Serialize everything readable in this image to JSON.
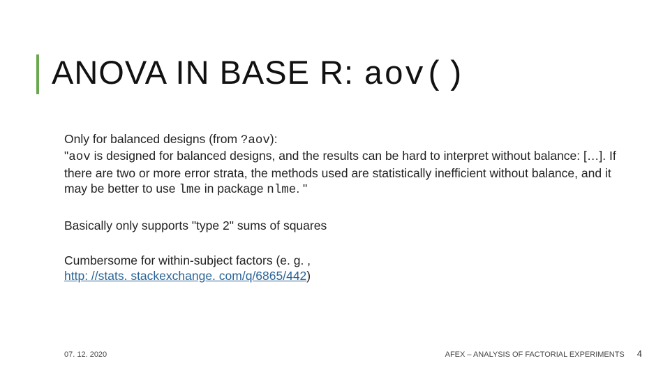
{
  "title": {
    "prefix": "ANOVA IN BASE R: ",
    "code": "aov()"
  },
  "body": {
    "p1": {
      "lead": "Only for balanced designs (from ",
      "code1": "?aov",
      "afterCode1": "):",
      "quoteOpen": "\"",
      "code2": "aov",
      "rest": " is designed for balanced designs, and the results can be hard to interpret without balance: […]. If there are two or more error strata, the methods used are statistically inefficient without balance, and it may be better to use ",
      "code3": "lme",
      "rest2": " in package ",
      "code4": "nlme",
      "tail": ". \""
    },
    "p2": "Basically only supports \"type 2\" sums of squares",
    "p3": {
      "lead": "Cumbersome for within-subject factors (e. g. , ",
      "link_text": "http: //stats. stackexchange. com/q/6865/442",
      "tail": ")"
    }
  },
  "footer": {
    "date": "07. 12. 2020",
    "source": "AFEX – ANALYSIS OF FACTORIAL EXPERIMENTS",
    "page": "4"
  }
}
